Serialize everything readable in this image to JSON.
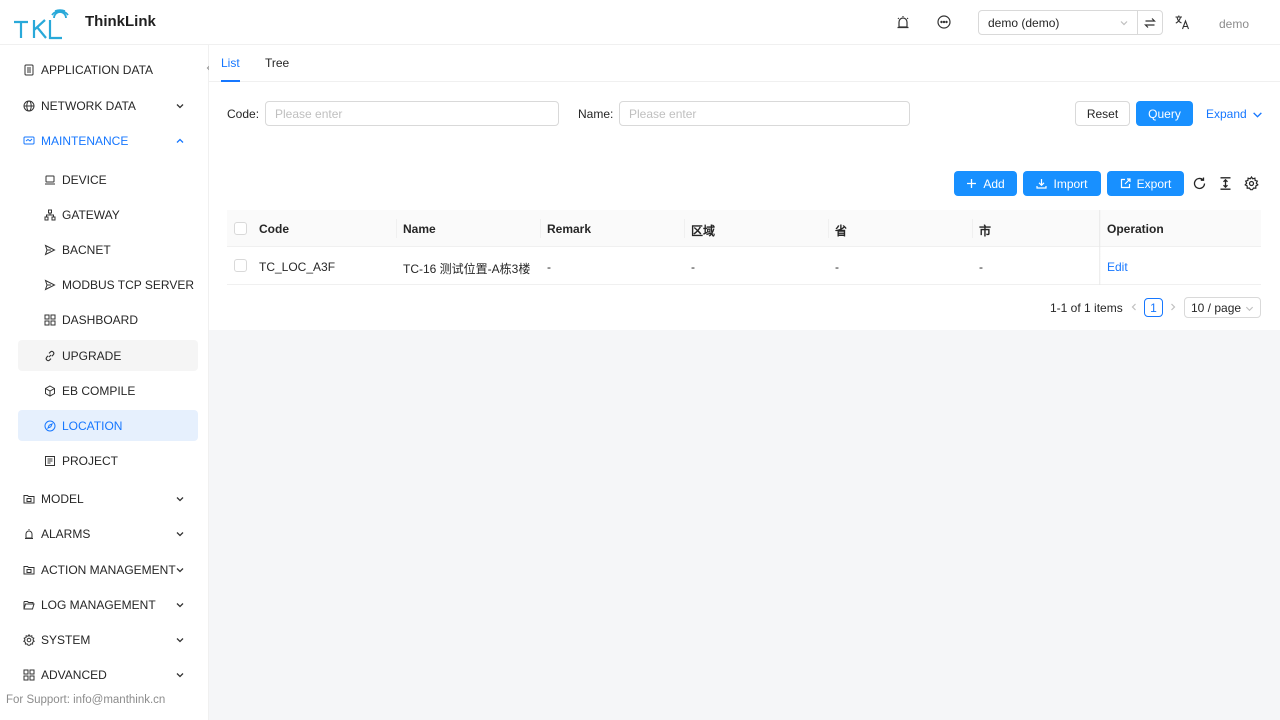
{
  "header": {
    "brand": "ThinkLink",
    "tenant_select": "demo (demo)",
    "user": "demo"
  },
  "sidebar": {
    "items": [
      {
        "label": "APPLICATION DATA",
        "icon": "document-icon"
      },
      {
        "label": "NETWORK DATA",
        "icon": "globe-icon"
      },
      {
        "label": "MAINTENANCE",
        "icon": "monitor-icon"
      },
      {
        "label": "DEVICE",
        "icon": "laptop-icon"
      },
      {
        "label": "GATEWAY",
        "icon": "cluster-icon"
      },
      {
        "label": "BACNET",
        "icon": "send-icon"
      },
      {
        "label": "MODBUS TCP SERVER",
        "icon": "send-icon"
      },
      {
        "label": "DASHBOARD",
        "icon": "dashboard-icon"
      },
      {
        "label": "UPGRADE",
        "icon": "link-icon"
      },
      {
        "label": "EB COMPILE",
        "icon": "code-sandbox-icon"
      },
      {
        "label": "LOCATION",
        "icon": "compass-icon"
      },
      {
        "label": "PROJECT",
        "icon": "project-icon"
      },
      {
        "label": "MODEL",
        "icon": "folder-icon"
      },
      {
        "label": "ALARMS",
        "icon": "alarm-icon"
      },
      {
        "label": "ACTION MANAGEMENT",
        "icon": "folder-icon"
      },
      {
        "label": "LOG MANAGEMENT",
        "icon": "folder-open-icon"
      },
      {
        "label": "SYSTEM",
        "icon": "gear-icon"
      },
      {
        "label": "ADVANCED",
        "icon": "appstore-icon"
      }
    ],
    "support": "For Support: info@manthink.cn"
  },
  "tabs": [
    "List",
    "Tree"
  ],
  "filters": {
    "code_label": "Code",
    "code_placeholder": "Please enter",
    "name_label": "Name",
    "name_placeholder": "Please enter",
    "reset": "Reset",
    "query": "Query",
    "expand": "Expand"
  },
  "toolbar": {
    "add": "Add",
    "import": "Import",
    "export": "Export"
  },
  "table": {
    "columns": [
      "Code",
      "Name",
      "Remark",
      "区域",
      "省",
      "市",
      "Operation"
    ],
    "rows": [
      {
        "code": "TC_LOC_A3F",
        "name": "TC-16 测试位置-A栋3楼",
        "remark": "-",
        "area": "-",
        "province": "-",
        "city": "-",
        "op": "Edit"
      }
    ]
  },
  "pagination": {
    "total": "1-1 of 1 items",
    "current": "1",
    "page_size": "10 / page"
  },
  "colors": {
    "accent": "#1677ff",
    "primary_button": "#1890ff",
    "active_menu_bg": "#e6f0fd"
  }
}
